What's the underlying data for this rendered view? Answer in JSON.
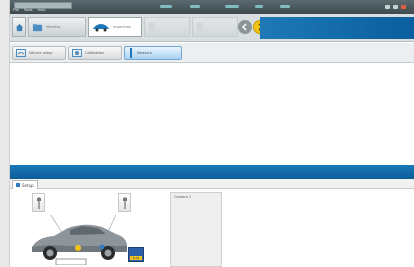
{
  "app": {
    "title": "",
    "menus": [
      "File",
      "Tools",
      "Help"
    ]
  },
  "tabs": [
    {
      "label": "Vehicles",
      "icon": "car-folder-icon",
      "state": "inactive"
    },
    {
      "label": "Inspection",
      "icon": "camera-car-icon",
      "state": "active"
    },
    {
      "label": "",
      "icon": "document-icon",
      "state": "disabled"
    },
    {
      "label": "",
      "icon": "report-icon",
      "state": "disabled"
    }
  ],
  "brand": {
    "text": ""
  },
  "subtabs": [
    {
      "label": "Vehicle setup",
      "icon": "car-settings-icon",
      "state": "inactive"
    },
    {
      "label": "Calibration",
      "icon": "target-icon",
      "state": "inactive"
    },
    {
      "label": "Measure",
      "icon": "measure-icon",
      "state": "active"
    }
  ],
  "panel": {
    "tab_label": "Setup",
    "list_items": [
      "Camera 1"
    ]
  },
  "badge": {
    "top_text": "",
    "bottom_text": "8.16"
  },
  "colors": {
    "accent_blue": "#1a78b8",
    "titlebar": "#4a585c",
    "nav_yellow": "#f2c315",
    "badge_blue": "#2b5fa8"
  }
}
